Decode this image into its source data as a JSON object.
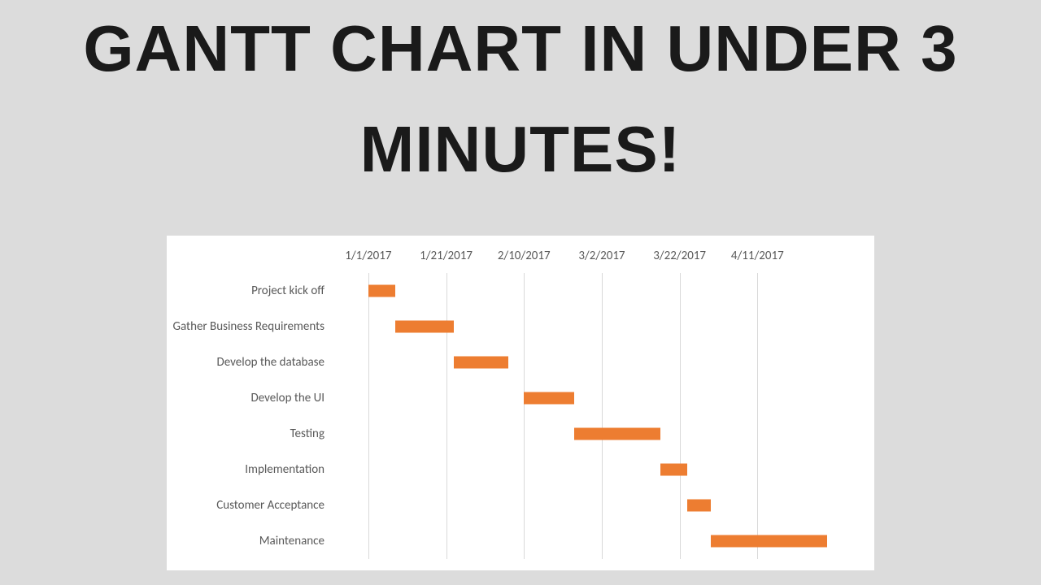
{
  "title": {
    "line1": "GANTT CHART IN UNDER 3",
    "line2": "MINUTES!"
  },
  "chart_data": {
    "type": "bar",
    "orientation": "horizontal",
    "title": "",
    "xlabel": "",
    "ylabel": "",
    "x_ticks": [
      "1/1/2017",
      "1/21/2017",
      "2/10/2017",
      "3/2/2017",
      "3/22/2017",
      "4/11/2017"
    ],
    "x_tick_serial": [
      42736,
      42756,
      42776,
      42796,
      42816,
      42836
    ],
    "xlim": [
      42726,
      42856
    ],
    "categories": [
      "Project kick off",
      "Gather Business Requirements",
      "Develop the database",
      "Develop the UI",
      "Testing",
      "Implementation",
      "Customer Acceptance",
      "Maintenance"
    ],
    "series": [
      {
        "name": "start_serial",
        "values": [
          42736,
          42743,
          42758,
          42776,
          42789,
          42811,
          42818,
          42824
        ]
      },
      {
        "name": "duration_days",
        "values": [
          7,
          15,
          14,
          13,
          22,
          7,
          6,
          30
        ]
      }
    ],
    "bar_color": "#ed7d31"
  }
}
